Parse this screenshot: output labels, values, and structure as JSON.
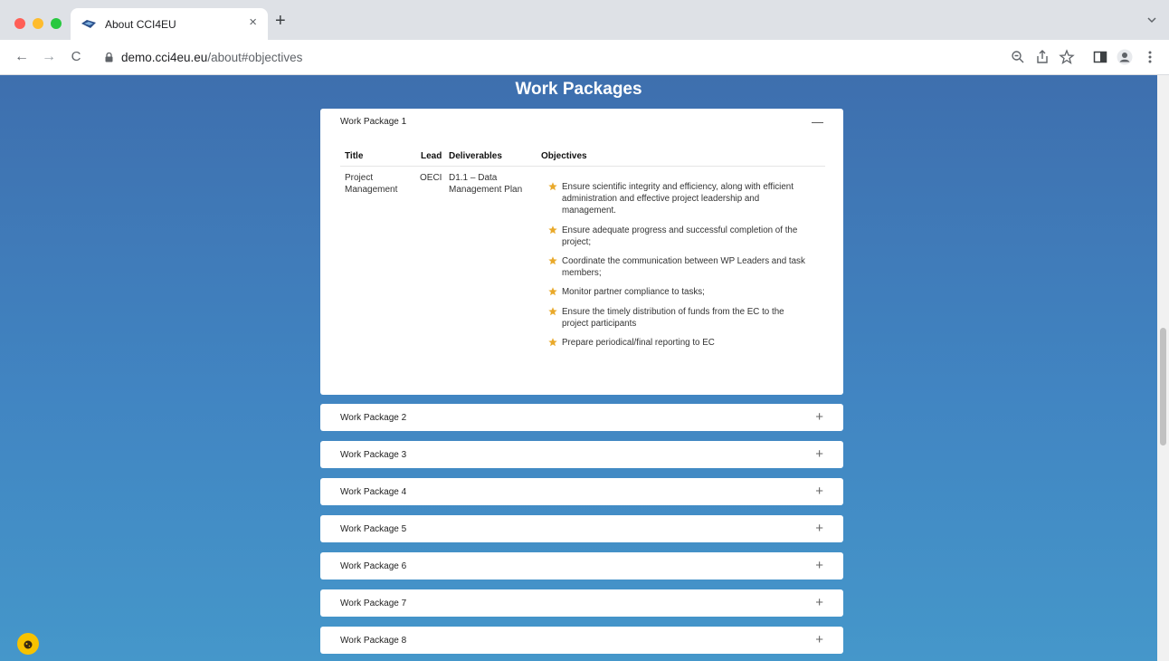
{
  "browser": {
    "tab_title": "About CCI4EU",
    "tab_close": "×",
    "new_tab": "+",
    "url_host": "demo.cci4eu.eu",
    "url_path": "/about#objectives",
    "back_icon": "←",
    "forward_icon": "→",
    "reload_icon": "C"
  },
  "page": {
    "section_title": "Work Packages",
    "open_package": {
      "header": "Work Package 1",
      "toggle": "—",
      "columns": {
        "title": "Title",
        "lead": "Lead",
        "deliverables": "Deliverables",
        "objectives": "Objectives"
      },
      "row": {
        "title": "Project Management",
        "lead": "OECI",
        "deliverables": "D1.1 – Data Management Plan",
        "objectives": [
          "Ensure scientific integrity and efficiency, along with efficient administration and effective project leadership and management.",
          "Ensure adequate progress and successful completion of the project;",
          "Coordinate the communication between WP Leaders and task members;",
          "Monitor partner compliance to tasks;",
          "Ensure the timely distribution of funds from the EC to the project participants",
          "Prepare periodical/final reporting to EC"
        ]
      }
    },
    "collapsed_packages": [
      {
        "label": "Work Package 2",
        "toggle": "+"
      },
      {
        "label": "Work Package 3",
        "toggle": "+"
      },
      {
        "label": "Work Package 4",
        "toggle": "+"
      },
      {
        "label": "Work Package 5",
        "toggle": "+"
      },
      {
        "label": "Work Package 6",
        "toggle": "+"
      },
      {
        "label": "Work Package 7",
        "toggle": "+"
      },
      {
        "label": "Work Package 8",
        "toggle": "+"
      }
    ]
  },
  "colors": {
    "accent_star": "#e9a92a",
    "bg_top": "#3e6fae",
    "bg_bottom": "#4597ca"
  },
  "icons": [
    "favicon-icon",
    "lock-icon",
    "zoom-icon",
    "share-icon",
    "bookmark-star-icon",
    "side-panel-icon",
    "profile-icon",
    "menu-dots-icon",
    "star-icon",
    "cookie-icon"
  ]
}
